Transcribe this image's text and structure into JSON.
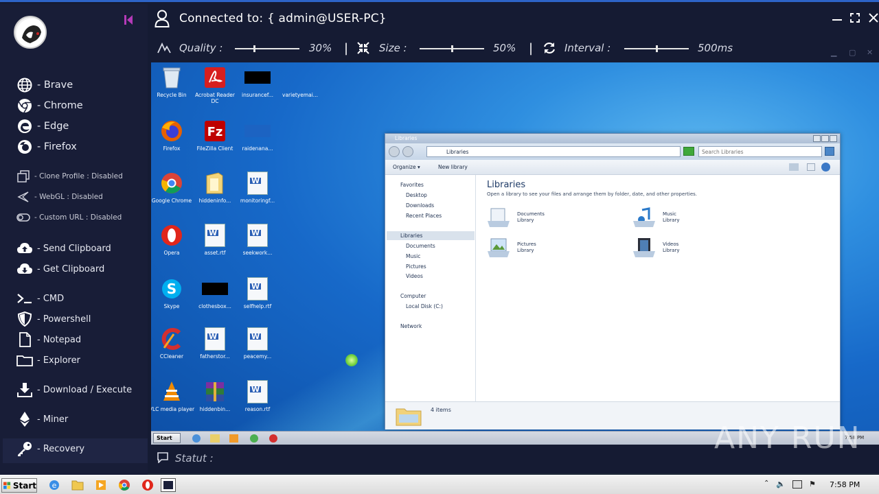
{
  "header": {
    "title": "Connected to: { admin@USER-PC}"
  },
  "toolbar": {
    "quality_label": "Quality :",
    "quality_value": "30%",
    "quality_level": 0.3,
    "size_label": "Size :",
    "size_value": "50%",
    "size_level": 0.5,
    "interval_label": "Interval :",
    "interval_value": "500ms",
    "interval_level": 0.5
  },
  "sidebar": {
    "browsers": [
      {
        "label": "- Brave",
        "icon": "globe-icon"
      },
      {
        "label": "- Chrome",
        "icon": "chrome-icon"
      },
      {
        "label": "- Edge",
        "icon": "edge-icon"
      },
      {
        "label": "- Firefox",
        "icon": "firefox-icon"
      }
    ],
    "options": [
      {
        "label": "- Clone Profile : Disabled",
        "icon": "clone-icon"
      },
      {
        "label": "- WebGL : Disabled",
        "icon": "webgl-icon"
      },
      {
        "label": "- Custom URL : Disabled",
        "icon": "toggle-icon"
      }
    ],
    "clipboard": [
      {
        "label": "- Send Clipboard",
        "icon": "cloud-upload-icon"
      },
      {
        "label": "- Get Clipboard",
        "icon": "cloud-download-icon"
      }
    ],
    "tools": [
      {
        "label": "- CMD",
        "icon": "terminal-icon"
      },
      {
        "label": "- Powershell",
        "icon": "shield-icon"
      },
      {
        "label": "- Notepad",
        "icon": "file-icon"
      },
      {
        "label": "- Explorer",
        "icon": "folder-icon"
      }
    ],
    "download": {
      "label": "- Download / Execute",
      "icon": "download-icon"
    },
    "miner": {
      "label": "- Miner",
      "icon": "ethereum-icon"
    },
    "recovery": {
      "label": "- Recovery",
      "icon": "key-icon"
    }
  },
  "remote_desktop": {
    "icons": [
      {
        "label": "Recycle Bin"
      },
      {
        "label": "Acrobat Reader DC"
      },
      {
        "label": "insurancef..."
      },
      {
        "label": "varietyemai..."
      },
      {
        "label": "Firefox"
      },
      {
        "label": "FileZilla Client"
      },
      {
        "label": "raidenana..."
      },
      {
        "label": "Google Chrome"
      },
      {
        "label": "hiddeninfo..."
      },
      {
        "label": "monitoringf..."
      },
      {
        "label": "Opera"
      },
      {
        "label": "asset.rtf"
      },
      {
        "label": "seekwork..."
      },
      {
        "label": "Skype"
      },
      {
        "label": "clothesbox..."
      },
      {
        "label": "selfhelp.rtf"
      },
      {
        "label": "CCleaner"
      },
      {
        "label": "fatherstor..."
      },
      {
        "label": "peacemy..."
      },
      {
        "label": "VLC media player"
      },
      {
        "label": "hiddenbin..."
      },
      {
        "label": "reason.rtf"
      }
    ],
    "explorer": {
      "title": "Libraries",
      "address": "Libraries",
      "search_placeholder": "Search Libraries",
      "organize": "Organize",
      "new_library": "New library",
      "nav": [
        "Favorites",
        "Desktop",
        "Downloads",
        "Recent Places",
        "Libraries",
        "Documents",
        "Music",
        "Pictures",
        "Videos",
        "Computer",
        "Local Disk (C:)",
        "Network"
      ],
      "heading": "Libraries",
      "subheading": "Open a library to see your files and arrange them by folder, date, and other properties.",
      "libraries": [
        {
          "name": "Documents",
          "type": "Library"
        },
        {
          "name": "Music",
          "type": "Library"
        },
        {
          "name": "Pictures",
          "type": "Library"
        },
        {
          "name": "Videos",
          "type": "Library"
        }
      ],
      "status": "4 items"
    },
    "taskbar": {
      "start": "Start",
      "clock": "7:58 PM"
    }
  },
  "statut": {
    "label": "Statut :"
  },
  "watermark": "ANY RUN",
  "host_taskbar": {
    "start": "Start",
    "clock": "7:58 PM"
  }
}
